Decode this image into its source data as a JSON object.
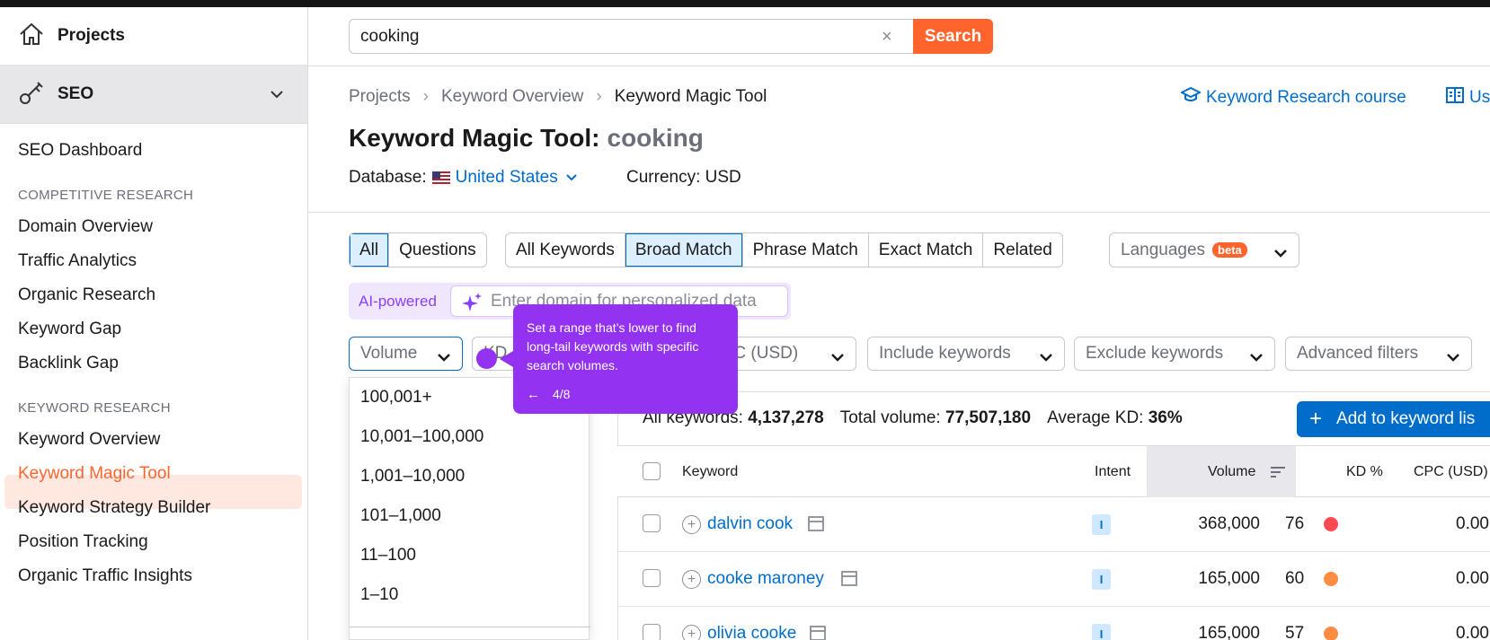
{
  "sidebar": {
    "projects": "Projects",
    "seo": "SEO",
    "items": [
      {
        "label": "SEO Dashboard"
      },
      {
        "label": "COMPETITIVE RESEARCH"
      },
      {
        "label": "Domain Overview"
      },
      {
        "label": "Traffic Analytics"
      },
      {
        "label": "Organic Research"
      },
      {
        "label": "Keyword Gap"
      },
      {
        "label": "Backlink Gap"
      },
      {
        "label": "KEYWORD RESEARCH"
      },
      {
        "label": "Keyword Overview"
      },
      {
        "label": "Keyword Magic Tool"
      },
      {
        "label": "Keyword Strategy Builder"
      },
      {
        "label": "Position Tracking"
      },
      {
        "label": "Organic Traffic Insights"
      }
    ]
  },
  "search": {
    "value": "cooking",
    "button": "Search",
    "clear": "×"
  },
  "breadcrumb": [
    "Projects",
    "Keyword Overview",
    "Keyword Magic Tool"
  ],
  "links": {
    "course": "Keyword Research course",
    "user": "Us"
  },
  "header": {
    "title": "Keyword Magic Tool:",
    "keyword": "cooking",
    "database_label": "Database:",
    "database": "United States",
    "currency": "Currency: USD"
  },
  "tabs": {
    "group1": [
      "All",
      "Questions"
    ],
    "group2": [
      "All Keywords",
      "Broad Match",
      "Phrase Match",
      "Exact Match",
      "Related"
    ],
    "languages": "Languages",
    "beta": "beta"
  },
  "ai": {
    "label": "AI-powered",
    "placeholder": "Enter domain for personalized data"
  },
  "filters": {
    "volume": "Volume",
    "kd": "KD",
    "cpc": "CPC (USD)",
    "include": "Include keywords",
    "exclude": "Exclude keywords",
    "advanced": "Advanced filters"
  },
  "volume_options": [
    "100,001+",
    "10,001–100,000",
    "1,001–10,000",
    "101–1,000",
    "11–100",
    "1–10"
  ],
  "tooltip": {
    "text": "Set a range that’s lower to find long-tail keywords with specific search volumes.",
    "step": "4/8",
    "back": "←"
  },
  "summary": {
    "all_label": "All keywords:",
    "all_value": "4,137,278",
    "total_label": "Total volume:",
    "total_value": "77,507,180",
    "kd_label": "Average KD:",
    "kd_value": "36%",
    "add_button": "Add to keyword lis"
  },
  "table": {
    "headers": {
      "keyword": "Keyword",
      "intent": "Intent",
      "volume": "Volume",
      "kd": "KD %",
      "cpc": "CPC (USD)"
    },
    "rows": [
      {
        "keyword": "dalvin cook",
        "intent": "I",
        "volume": "368,000",
        "kd": "76",
        "kd_color": "#ff4953",
        "cpc": "0.00"
      },
      {
        "keyword": "cooke maroney",
        "intent": "I",
        "volume": "165,000",
        "kd": "60",
        "kd_color": "#ff8c43",
        "cpc": "0.00"
      },
      {
        "keyword": "olivia cooke",
        "intent": "I",
        "volume": "165,000",
        "kd": "57",
        "kd_color": "#ff8c43",
        "cpc": "0.00"
      }
    ]
  },
  "colors": {
    "brand": "#ff642d",
    "link": "#006dca",
    "tooltip": "#9332f0"
  }
}
